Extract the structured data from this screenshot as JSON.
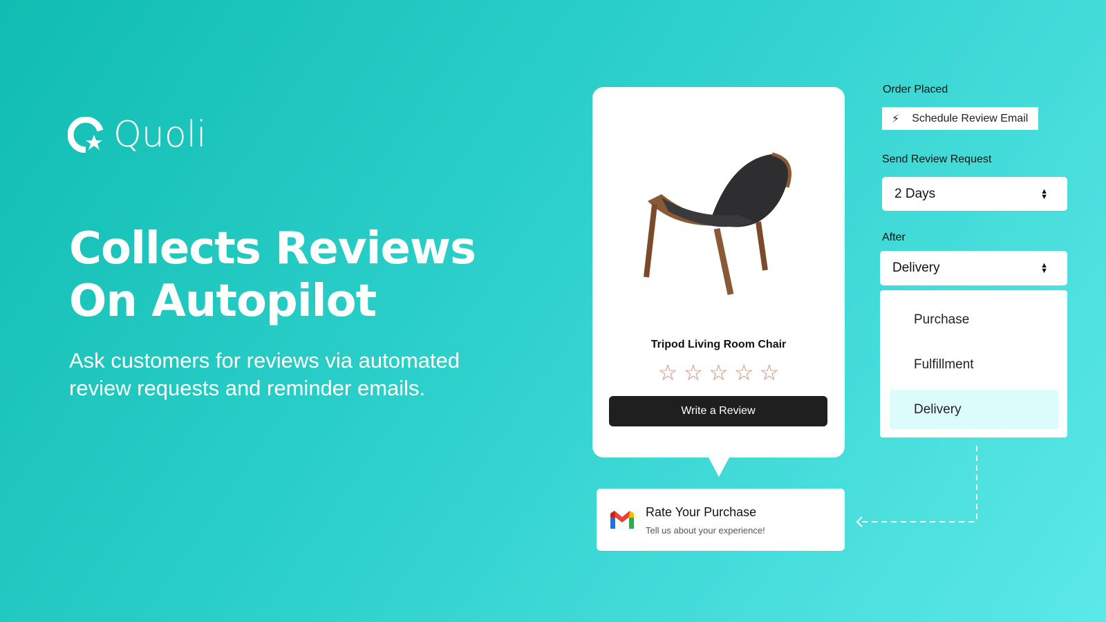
{
  "brand": {
    "name": "Quoli"
  },
  "hero": {
    "headline_line1": "Collects Reviews",
    "headline_line2": "On Autopilot",
    "subtitle": "Ask customers for reviews via automated review requests and reminder emails."
  },
  "product_card": {
    "name": "Tripod Living Room Chair",
    "rating": 0,
    "max_rating": 5,
    "button": "Write a Review"
  },
  "email": {
    "title": "Rate Your Purchase",
    "subtitle": "Tell us about your experience!",
    "icon": "gmail-icon"
  },
  "workflow": {
    "order_label": "Order Placed",
    "schedule_button": "Schedule Review Email",
    "send_label": "Send Review Request",
    "send_value": "2 Days",
    "after_label": "After",
    "after_value": "Delivery",
    "options": [
      "Purchase",
      "Fulfillment",
      "Delivery"
    ],
    "selected_option": "Delivery"
  },
  "colors": {
    "accent": "#10bdb1",
    "button": "#1f1f1f",
    "highlight": "#dcfcfc",
    "star": "#d08a78"
  }
}
